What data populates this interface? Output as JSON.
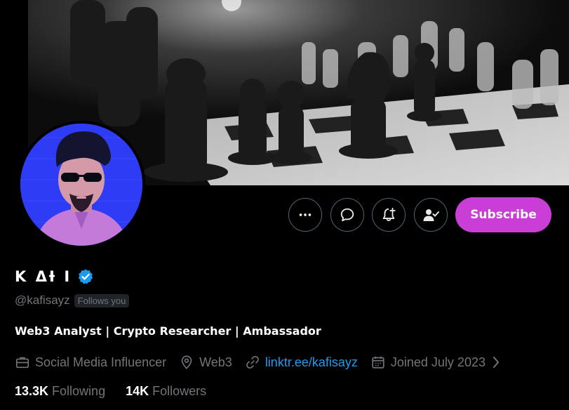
{
  "profile": {
    "display_name": "K ΔƗ I",
    "handle": "@kafisayz",
    "follows_you": "Follows you",
    "bio": "Web3 Analyst | Crypto Researcher |  Ambassador",
    "category": "Social Media Influencer",
    "location": "Web3",
    "website": "linktr.ee/kafisayz",
    "joined": "Joined July 2023",
    "verified": true
  },
  "actions": {
    "subscribe_label": "Subscribe",
    "more_icon": "more-horizontal-icon",
    "message_icon": "message-bubble-icon",
    "notify_icon": "bell-plus-icon",
    "following_icon": "user-check-icon"
  },
  "stats": {
    "following_count": "13.3K",
    "following_label": "Following",
    "followers_count": "14K",
    "followers_label": "Followers"
  },
  "colors": {
    "background": "#000000",
    "subscribe": "#c93fd6",
    "link": "#1d9bf0",
    "verified": "#1d9bf0",
    "muted_text": "#71767b"
  }
}
